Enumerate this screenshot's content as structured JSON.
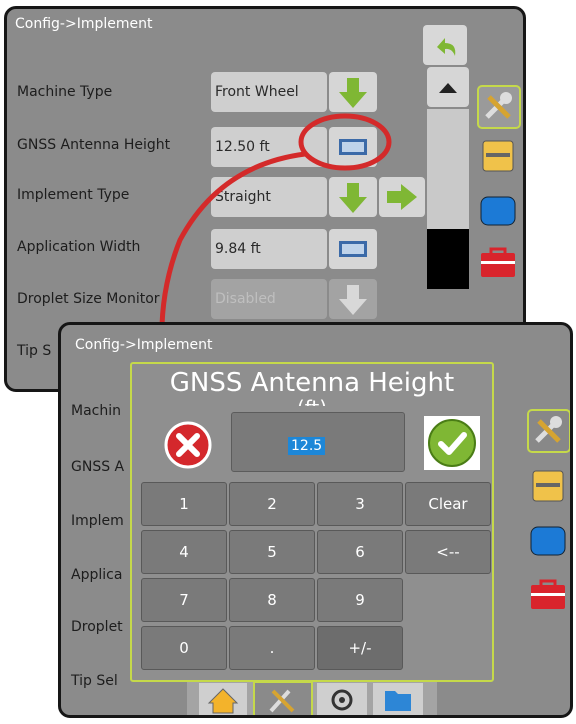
{
  "top": {
    "title": "Config->Implement",
    "rows": [
      {
        "label": "Machine Type",
        "value": "Front Wheel"
      },
      {
        "label": "GNSS Antenna Height",
        "value": "12.50 ft"
      },
      {
        "label": "Implement Type",
        "value": "Straight"
      },
      {
        "label": "Application Width",
        "value": "9.84 ft"
      },
      {
        "label": "Droplet Size Monitor",
        "value": "Disabled"
      },
      {
        "label": "Tip S",
        "value": ""
      }
    ]
  },
  "bottom": {
    "title": "Config->Implement",
    "left_labels": [
      "Machin",
      "GNSS A",
      "Implem",
      "Applica",
      "Droplet",
      "Tip Sel"
    ]
  },
  "dialog": {
    "title": "GNSS Antenna Height",
    "unit_partial": "(ft)",
    "value": "12.5",
    "keys": [
      [
        "1",
        "2",
        "3",
        "Clear"
      ],
      [
        "4",
        "5",
        "6",
        "<--"
      ],
      [
        "7",
        "8",
        "9",
        ""
      ],
      [
        "0",
        ".",
        "+/-",
        ""
      ]
    ]
  },
  "colors": {
    "panel": "#8b8b8b",
    "accent_green": "#7fb734",
    "highlight_green": "#c5d94a",
    "cancel_red": "#d4282c",
    "annotation_red": "#d42a2a"
  }
}
